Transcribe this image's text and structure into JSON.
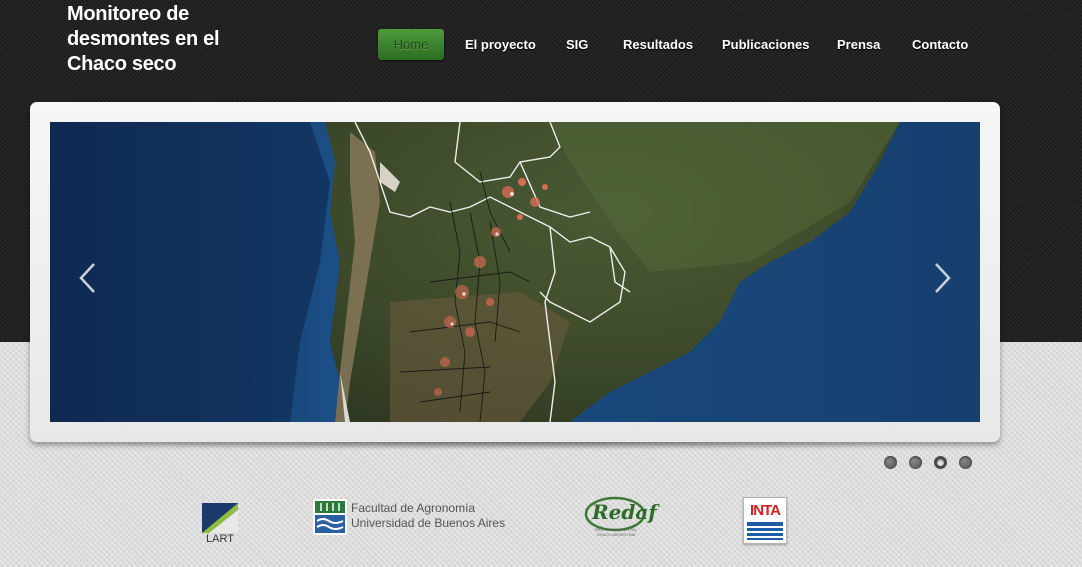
{
  "site": {
    "title": "Monitoreo de desmontes en el Chaco seco"
  },
  "nav": {
    "items": [
      {
        "label": "Home",
        "active": true
      },
      {
        "label": "El proyecto"
      },
      {
        "label": "SIG"
      },
      {
        "label": "Resultados"
      },
      {
        "label": "Publicaciones"
      },
      {
        "label": "Prensa"
      },
      {
        "label": "Contacto"
      }
    ]
  },
  "slider": {
    "prev_icon": "chevron-left-icon",
    "next_icon": "chevron-right-icon",
    "slide_count": 4,
    "active_index": 2
  },
  "logos": {
    "lart": {
      "text": "LART"
    },
    "fauba": {
      "line1": "Facultad de Agronomía",
      "line2": "Universidad de Buenos Aires"
    },
    "redaf": {
      "text": "Redaf",
      "sub": "RED AGROFORESTAL CHACO ARGENTINA"
    },
    "inta": {
      "text": "INTA"
    }
  },
  "colors": {
    "header_bg": "#222222",
    "nav_active": "#3f8a30",
    "page_bg": "#dcdcdc"
  }
}
